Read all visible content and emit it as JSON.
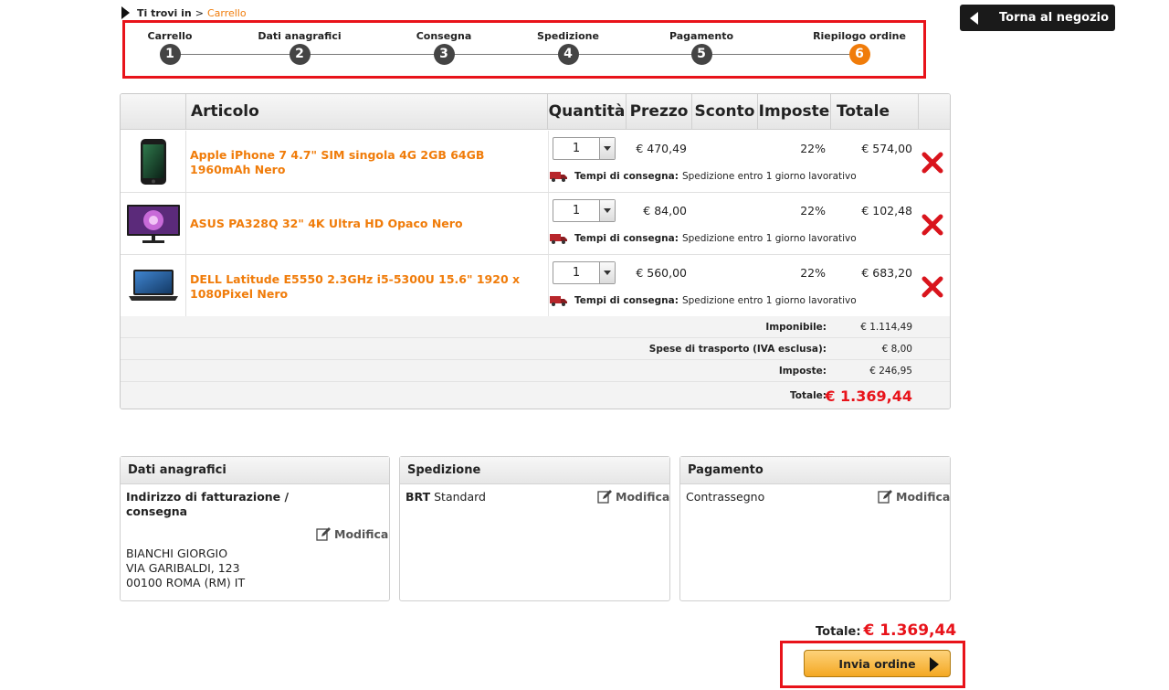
{
  "breadcrumb": {
    "prefix": "Ti trovi in",
    "separator": ">",
    "current": "Carrello"
  },
  "back_button": {
    "label": "Torna al negozio"
  },
  "steps": [
    {
      "label": "Carrello",
      "number": "1"
    },
    {
      "label": "Dati anagrafici",
      "number": "2"
    },
    {
      "label": "Consegna",
      "number": "3"
    },
    {
      "label": "Spedizione",
      "number": "4"
    },
    {
      "label": "Pagamento",
      "number": "5"
    },
    {
      "label": "Riepilogo ordine",
      "number": "6"
    }
  ],
  "active_step": 6,
  "cart": {
    "headers": {
      "article": "Articolo",
      "quantity": "Quantità",
      "price": "Prezzo",
      "discount": "Sconto",
      "taxes": "Imposte",
      "total": "Totale"
    },
    "items": [
      {
        "name": "Apple iPhone 7 4.7\" SIM singola 4G 2GB 64GB 1960mAh Nero",
        "quantity": "1",
        "price": "€ 470,49",
        "discount": "",
        "tax": "22%",
        "total": "€ 574,00",
        "delivery_label": "Tempi di consegna:",
        "delivery_text": "Spedizione entro 1 giorno lavorativo",
        "icon": "smartphone-icon"
      },
      {
        "name": "ASUS PA328Q 32\" 4K Ultra HD Opaco Nero",
        "quantity": "1",
        "price": "€ 84,00",
        "discount": "",
        "tax": "22%",
        "total": "€ 102,48",
        "delivery_label": "Tempi di consegna:",
        "delivery_text": "Spedizione entro 1 giorno lavorativo",
        "icon": "monitor-icon"
      },
      {
        "name": "DELL Latitude E5550 2.3GHz i5-5300U 15.6\" 1920 x 1080Pixel Nero",
        "quantity": "1",
        "price": "€ 560,00",
        "discount": "",
        "tax": "22%",
        "total": "€ 683,20",
        "delivery_label": "Tempi di consegna:",
        "delivery_text": "Spedizione entro 1 giorno lavorativo",
        "icon": "laptop-icon"
      }
    ],
    "summary": {
      "taxable_label": "Imponibile:",
      "taxable_value": "€ 1.114,49",
      "shipping_label": "Spese di trasporto (IVA esclusa):",
      "shipping_value": "€ 8,00",
      "taxes_label": "Imposte:",
      "taxes_value": "€ 246,95",
      "total_label": "Totale:",
      "total_value": "€ 1.369,44"
    }
  },
  "boxes": {
    "personal": {
      "title": "Dati anagrafici",
      "address_heading_1": "Indirizzo di fatturazione /",
      "address_heading_2": "consegna",
      "edit_label": "Modifica",
      "name": "BIANCHI GIORGIO",
      "street": "VIA GARIBALDI, 123",
      "city": "00100 ROMA (RM) IT"
    },
    "shipping": {
      "title": "Spedizione",
      "carrier": "BRT",
      "service": "Standard",
      "edit_label": "Modifica"
    },
    "payment": {
      "title": "Pagamento",
      "method": "Contrassegno",
      "edit_label": "Modifica"
    }
  },
  "footer": {
    "total_label": "Totale:",
    "total_value": "€ 1.369,44",
    "send_label": "Invia ordine"
  },
  "colors": {
    "accent": "#f07c0a",
    "highlight": "#e8131a",
    "dark": "#1a1a1a"
  }
}
